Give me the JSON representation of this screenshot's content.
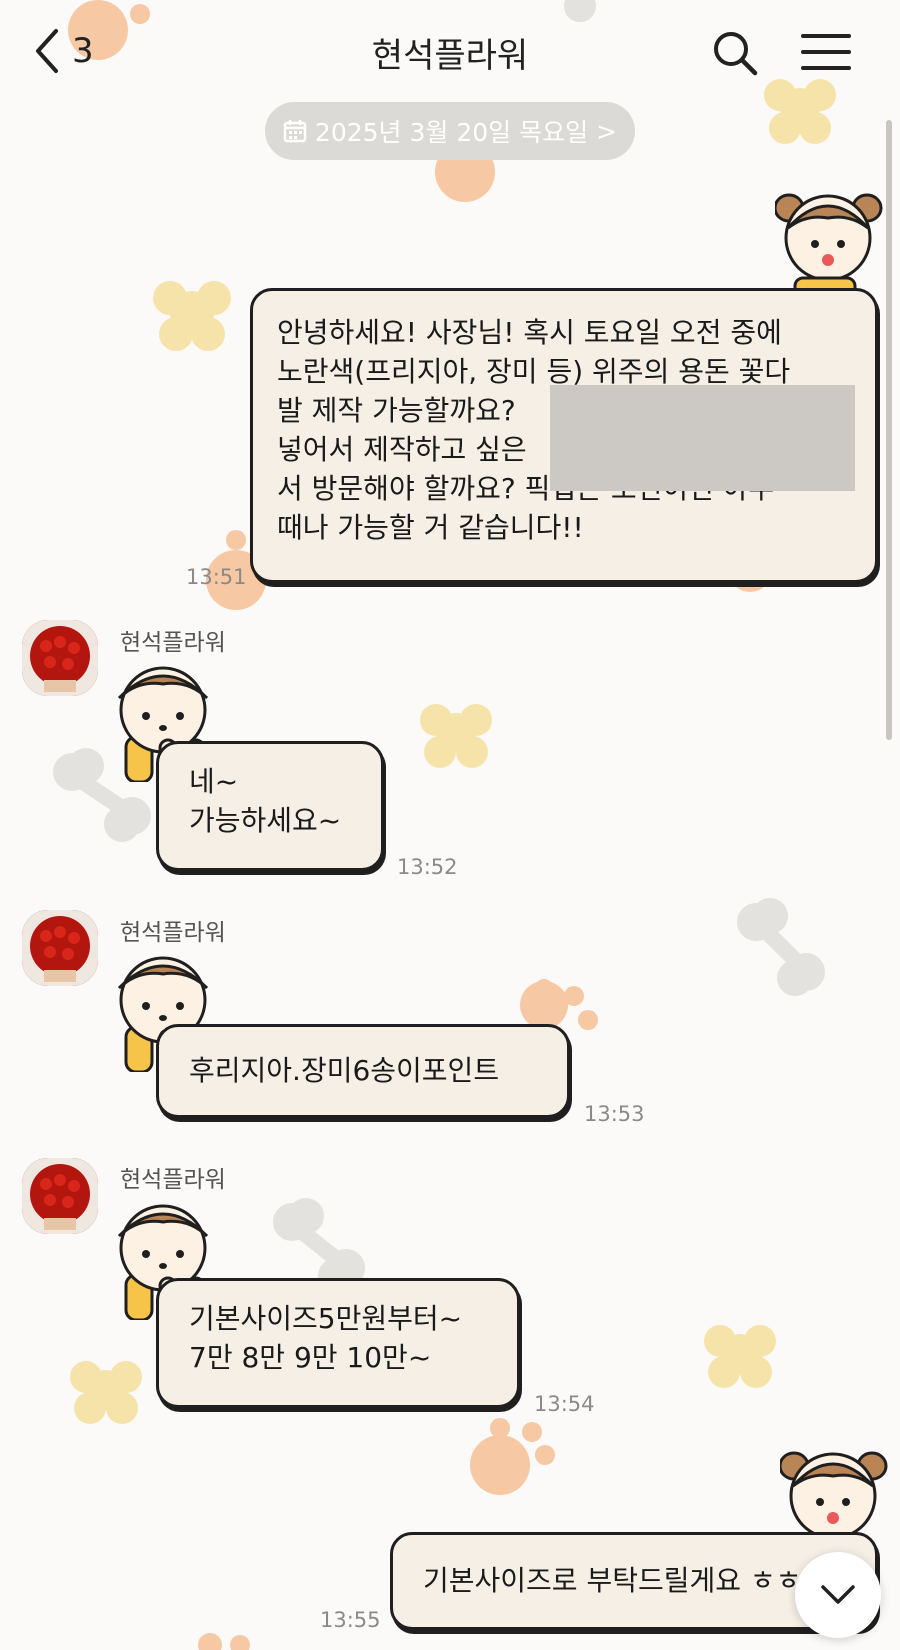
{
  "header": {
    "back_count": "3",
    "title": "현석플라워"
  },
  "date_pill": {
    "label": "2025년 3월 20일 목요일",
    "chevron": ">"
  },
  "sender_name": "현석플라워",
  "messages": [
    {
      "direction": "outgoing",
      "lines": [
        "안녕하세요! 사장님! 혹시 토요일 오전 중에",
        "노란색(프리지아, 장미 등) 위주의 용돈 꽃다",
        "발 제작 가능할까요?",
        "넣어서 제작하고 싶은",
        "서 방문해야 할까요? 픽업은 오전이면 아무",
        "때나 가능할 거 같습니다!!"
      ],
      "time": "13:51"
    },
    {
      "direction": "incoming",
      "lines": [
        "네~",
        "가능하세요~"
      ],
      "time": "13:52"
    },
    {
      "direction": "incoming",
      "lines": [
        "후리지아.장미6송이포인트"
      ],
      "time": "13:53"
    },
    {
      "direction": "incoming",
      "lines": [
        "기본사이즈5만원부터~",
        "7만 8만 9만 10만~"
      ],
      "time": "13:54"
    },
    {
      "direction": "outgoing",
      "lines": [
        "기본사이즈로 부탁드릴게요 ㅎㅎ"
      ],
      "time": "13:55"
    }
  ],
  "colors": {
    "bubble_bg": "#f5efe6",
    "bubble_border": "#1f1f1f",
    "date_pill_bg": "#dcdad7",
    "time_text": "#8a8a8a"
  },
  "icons": [
    "back-icon",
    "search-icon",
    "menu-icon",
    "calendar-icon",
    "scroll-down-icon"
  ]
}
